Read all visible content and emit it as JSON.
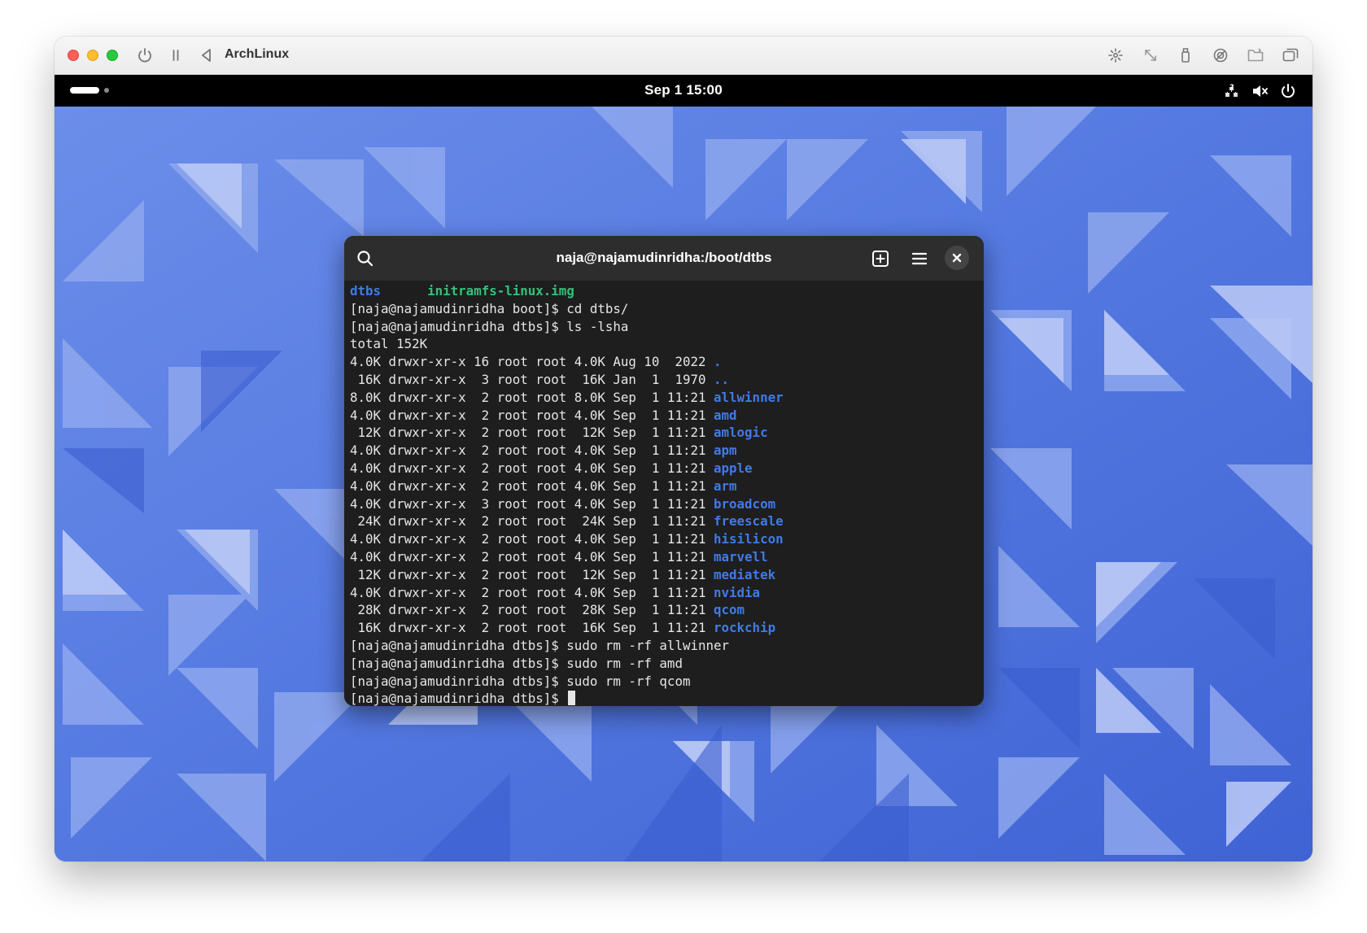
{
  "vm": {
    "title": "ArchLinux",
    "colors": {
      "close": "#ff5f57",
      "minimize": "#febc2e",
      "zoom": "#28c840"
    },
    "toolbar_icons": [
      "power-icon",
      "pause-icon",
      "back-icon",
      "brightness-icon",
      "resize-icon",
      "usb-icon",
      "display-icon",
      "folder-icon",
      "windows-icon"
    ]
  },
  "guest": {
    "topbar": {
      "clock": "Sep 1  15:00",
      "status_icons": [
        "network-unknown-icon",
        "volume-muted-icon",
        "power-icon"
      ]
    },
    "wallpaper": {
      "base_color": "#4f72e0",
      "light_color": "#b8c6f5"
    }
  },
  "terminal": {
    "title": "naja@najamudinridha:/boot/dtbs",
    "header_icons": [
      "search-icon",
      "new-tab-icon",
      "menu-icon",
      "close-icon"
    ],
    "colors": {
      "background": "#1e1e1e",
      "header": "#2d2d2d",
      "text": "#e6e6e6",
      "directory": "#3f7be8",
      "image": "#33c27a"
    },
    "lines": [
      {
        "segments": [
          {
            "t": "dtbs",
            "c": "dir"
          },
          {
            "t": "      ",
            "c": ""
          },
          {
            "t": "initramfs-linux.img",
            "c": "exe"
          }
        ]
      },
      {
        "segments": [
          {
            "t": "[naja@najamudinridha boot]$ cd dtbs/",
            "c": ""
          }
        ]
      },
      {
        "segments": [
          {
            "t": "[naja@najamudinridha dtbs]$ ls -lsha",
            "c": ""
          }
        ]
      },
      {
        "segments": [
          {
            "t": "total 152K",
            "c": ""
          }
        ]
      },
      {
        "segments": [
          {
            "t": "4.0K drwxr-xr-x 16 root root 4.0K Aug 10  2022 ",
            "c": ""
          },
          {
            "t": ".",
            "c": "dir"
          }
        ]
      },
      {
        "segments": [
          {
            "t": " 16K drwxr-xr-x  3 root root  16K Jan  1  1970 ",
            "c": ""
          },
          {
            "t": "..",
            "c": "dir"
          }
        ]
      },
      {
        "segments": [
          {
            "t": "8.0K drwxr-xr-x  2 root root 8.0K Sep  1 11:21 ",
            "c": ""
          },
          {
            "t": "allwinner",
            "c": "dir"
          }
        ]
      },
      {
        "segments": [
          {
            "t": "4.0K drwxr-xr-x  2 root root 4.0K Sep  1 11:21 ",
            "c": ""
          },
          {
            "t": "amd",
            "c": "dir"
          }
        ]
      },
      {
        "segments": [
          {
            "t": " 12K drwxr-xr-x  2 root root  12K Sep  1 11:21 ",
            "c": ""
          },
          {
            "t": "amlogic",
            "c": "dir"
          }
        ]
      },
      {
        "segments": [
          {
            "t": "4.0K drwxr-xr-x  2 root root 4.0K Sep  1 11:21 ",
            "c": ""
          },
          {
            "t": "apm",
            "c": "dir"
          }
        ]
      },
      {
        "segments": [
          {
            "t": "4.0K drwxr-xr-x  2 root root 4.0K Sep  1 11:21 ",
            "c": ""
          },
          {
            "t": "apple",
            "c": "dir"
          }
        ]
      },
      {
        "segments": [
          {
            "t": "4.0K drwxr-xr-x  2 root root 4.0K Sep  1 11:21 ",
            "c": ""
          },
          {
            "t": "arm",
            "c": "dir"
          }
        ]
      },
      {
        "segments": [
          {
            "t": "4.0K drwxr-xr-x  3 root root 4.0K Sep  1 11:21 ",
            "c": ""
          },
          {
            "t": "broadcom",
            "c": "dir"
          }
        ]
      },
      {
        "segments": [
          {
            "t": " 24K drwxr-xr-x  2 root root  24K Sep  1 11:21 ",
            "c": ""
          },
          {
            "t": "freescale",
            "c": "dir"
          }
        ]
      },
      {
        "segments": [
          {
            "t": "4.0K drwxr-xr-x  2 root root 4.0K Sep  1 11:21 ",
            "c": ""
          },
          {
            "t": "hisilicon",
            "c": "dir"
          }
        ]
      },
      {
        "segments": [
          {
            "t": "4.0K drwxr-xr-x  2 root root 4.0K Sep  1 11:21 ",
            "c": ""
          },
          {
            "t": "marvell",
            "c": "dir"
          }
        ]
      },
      {
        "segments": [
          {
            "t": " 12K drwxr-xr-x  2 root root  12K Sep  1 11:21 ",
            "c": ""
          },
          {
            "t": "mediatek",
            "c": "dir"
          }
        ]
      },
      {
        "segments": [
          {
            "t": "4.0K drwxr-xr-x  2 root root 4.0K Sep  1 11:21 ",
            "c": ""
          },
          {
            "t": "nvidia",
            "c": "dir"
          }
        ]
      },
      {
        "segments": [
          {
            "t": " 28K drwxr-xr-x  2 root root  28K Sep  1 11:21 ",
            "c": ""
          },
          {
            "t": "qcom",
            "c": "dir"
          }
        ]
      },
      {
        "segments": [
          {
            "t": " 16K drwxr-xr-x  2 root root  16K Sep  1 11:21 ",
            "c": ""
          },
          {
            "t": "rockchip",
            "c": "dir"
          }
        ]
      },
      {
        "segments": [
          {
            "t": "[naja@najamudinridha dtbs]$ sudo rm -rf allwinner",
            "c": ""
          }
        ]
      },
      {
        "segments": [
          {
            "t": "[naja@najamudinridha dtbs]$ sudo rm -rf amd",
            "c": ""
          }
        ]
      },
      {
        "segments": [
          {
            "t": "[naja@najamudinridha dtbs]$ sudo rm -rf qcom",
            "c": ""
          }
        ]
      },
      {
        "segments": [
          {
            "t": "[naja@najamudinridha dtbs]$ ",
            "c": ""
          }
        ]
      }
    ]
  }
}
